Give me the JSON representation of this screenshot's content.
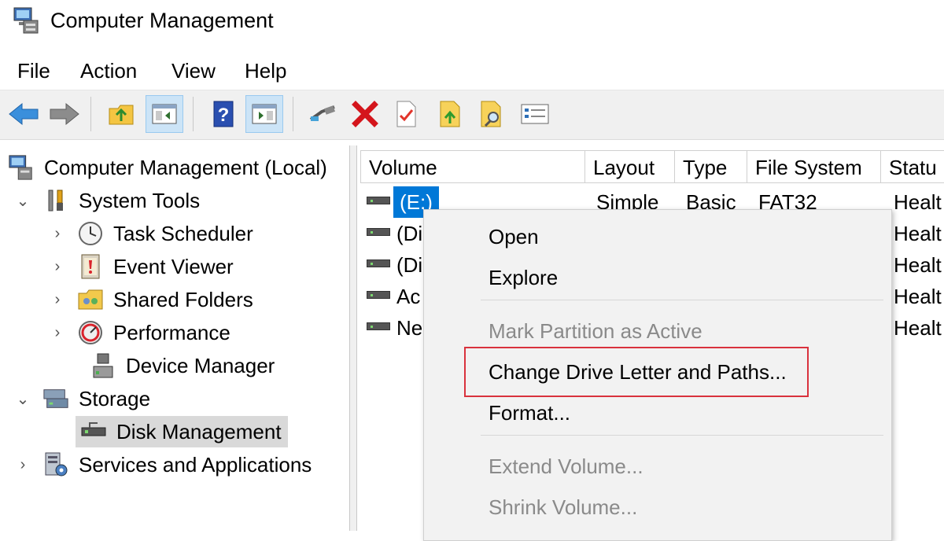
{
  "window": {
    "title": "Computer Management"
  },
  "menu": [
    "File",
    "Action",
    "View",
    "Help"
  ],
  "toolbar": {
    "icons": [
      "back-arrow-icon",
      "forward-arrow-icon",
      "up-folder-icon",
      "show-hide-console-tree-icon",
      "help-icon",
      "show-hide-action-pane-icon",
      "connect-icon",
      "delete-icon",
      "check-icon",
      "folder-up-icon",
      "folder-search-icon",
      "properties-icon"
    ]
  },
  "tree": {
    "root": "Computer Management (Local)",
    "system_tools": "System Tools",
    "task_scheduler": "Task Scheduler",
    "event_viewer": "Event Viewer",
    "shared_folders": "Shared Folders",
    "performance": "Performance",
    "device_manager": "Device Manager",
    "storage": "Storage",
    "disk_management": "Disk Management",
    "services": "Services and Applications"
  },
  "table": {
    "headers": [
      "Volume",
      "Layout",
      "Type",
      "File System",
      "Statu"
    ],
    "rows": [
      {
        "volume": "(E:)",
        "layout": "Simple",
        "type": "Basic",
        "fs": "FAT32",
        "status": "Healt"
      },
      {
        "volume": "(Di",
        "status": "Healt"
      },
      {
        "volume": "(Di",
        "status": "Healt"
      },
      {
        "volume": "Ac",
        "status": "Healt"
      },
      {
        "volume": "Ne",
        "status": "Healt"
      }
    ]
  },
  "context_menu": {
    "open": "Open",
    "explore": "Explore",
    "mark_active": "Mark Partition as Active",
    "change_letter": "Change Drive Letter and Paths...",
    "format": "Format...",
    "extend": "Extend Volume...",
    "shrink": "Shrink Volume..."
  },
  "colors": {
    "selection": "#0078d7",
    "highlight_box": "#d9323d",
    "delete_x": "#d4151c"
  }
}
